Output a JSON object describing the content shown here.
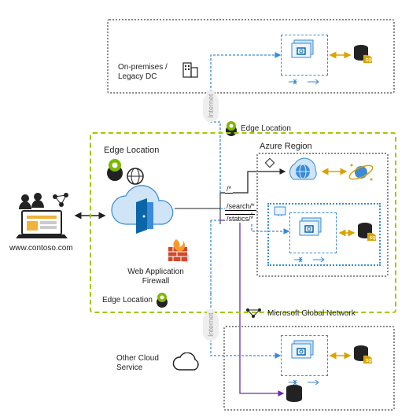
{
  "client": {
    "url": "www.contoso.com"
  },
  "edge": {
    "title1": "Edge Location",
    "title2": "Edge Location",
    "title3": "Edge Location",
    "waf": "Web Application\nFirewall"
  },
  "onprem": {
    "title": "On-premises /\nLegacy DC"
  },
  "azure": {
    "title": "Azure Region"
  },
  "msnet": {
    "title": "Microsoft Global Network"
  },
  "othercloud": {
    "title": "Other Cloud\nService"
  },
  "routes": {
    "root": "/*",
    "search": "/search/*",
    "statics": "/statics/*"
  },
  "internet_label": "Internet",
  "icons": {
    "users": "users-icon",
    "building": "building-icon",
    "location_pin": "location-pin-icon",
    "globe_black": "globe-icon",
    "cloud_door": "front-door-icon",
    "firewall": "firewall-icon",
    "vmss": "vm-scale-set-icon",
    "vmss_small": "vm-icon",
    "sql": "sql-database-icon",
    "app_service": "app-service-icon",
    "cosmos": "cosmos-db-icon",
    "cloud_outline": "cloud-icon",
    "database": "database-icon",
    "network": "network-icon"
  },
  "colors": {
    "green": "#a1c900",
    "blue": "#3a8ad6",
    "darkblue": "#0b66a9",
    "purple": "#6a2da6",
    "gold": "#d9a400",
    "gray": "#888",
    "black": "#222"
  }
}
